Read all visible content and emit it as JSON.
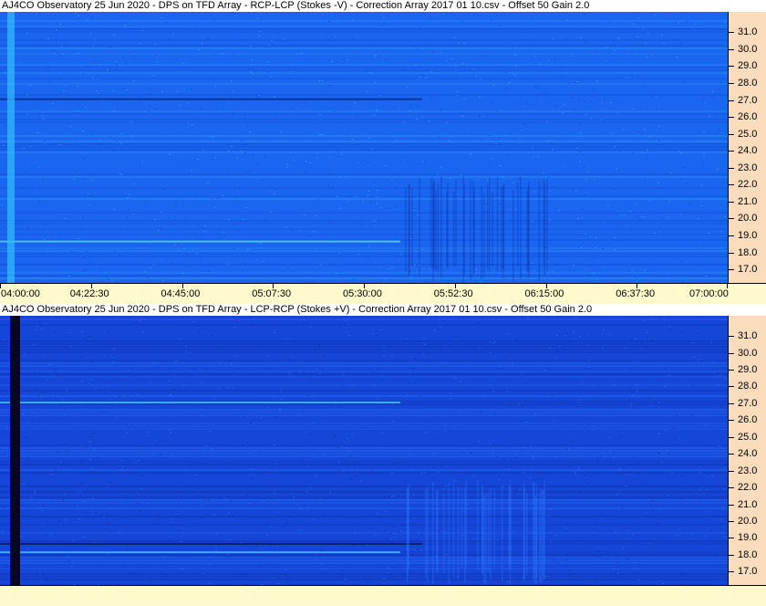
{
  "chart_data": [
    {
      "type": "heatmap",
      "title": "AJ4CO Observatory 25 Jun 2020  -  DPS on TFD Array  -  RCP-LCP (Stokes -V)  -  Correction Array 2017 01 10.csv  -  Offset 50  Gain 2.0",
      "ylabel": "",
      "xlabel": "",
      "y_ticks": [
        "17.0",
        "18.0",
        "19.0",
        "20.0",
        "21.0",
        "22.0",
        "23.0",
        "24.0",
        "25.0",
        "26.0",
        "27.0",
        "28.0",
        "29.0",
        "30.0",
        "31.0"
      ],
      "ylim": [
        16.2,
        32.2
      ],
      "x_ticks": [
        "04:00:00",
        "04:22:30",
        "04:45:00",
        "05:07:30",
        "05:30:00",
        "05:52:30",
        "06:15:00",
        "06:37:30",
        "07:00:00"
      ],
      "xlim": [
        "04:00:00",
        "07:00:00"
      ],
      "palette": {
        "base": "#1a66f0",
        "dark": "#0d3fc8",
        "light": "#3fa8ff",
        "band": "#58c8ff"
      },
      "features": {
        "bright_band_mhz": [
          18.7
        ],
        "dark_band_mhz": [
          27.1
        ],
        "left_edge_column": "bright"
      }
    },
    {
      "type": "heatmap",
      "title": "AJ4CO Observatory 25 Jun 2020  -  DPS on TFD Array  -  LCP-RCP (Stokes +V)  -  Correction Array 2017 01 10.csv  -  Offset 50  Gain 2.0",
      "ylabel": "",
      "xlabel": "",
      "y_ticks": [
        "17.0",
        "18.0",
        "19.0",
        "20.0",
        "21.0",
        "22.0",
        "23.0",
        "24.0",
        "25.0",
        "26.0",
        "27.0",
        "28.0",
        "29.0",
        "30.0",
        "31.0"
      ],
      "ylim": [
        16.2,
        32.2
      ],
      "x_ticks": [],
      "palette": {
        "base": "#1546d8",
        "dark": "#0a2a9a",
        "light": "#2e78ff",
        "band": "#46b4ff"
      },
      "features": {
        "bright_band_mhz": [
          27.1,
          18.2
        ],
        "dark_band_mhz": [
          18.7
        ],
        "left_edge_column": "dark"
      }
    }
  ]
}
